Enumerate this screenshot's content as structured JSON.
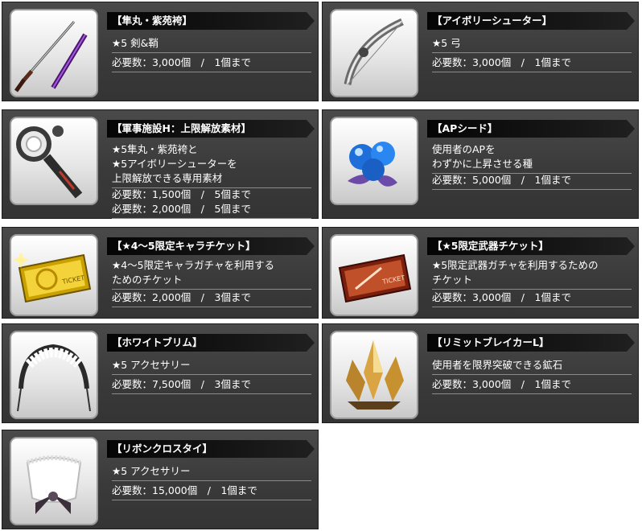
{
  "items": [
    {
      "title": "【隼丸・紫苑袴】",
      "desc": [
        "★5 剣&鞘"
      ],
      "req": [
        "必要数：3,000個　/　1個まで"
      ],
      "icon": "katana-icon"
    },
    {
      "title": "【アイボリーシューター】",
      "desc": [
        "★5 弓"
      ],
      "req": [
        "必要数：3,000個　/　1個まで"
      ],
      "icon": "bow-icon"
    },
    {
      "title": "【軍事施設H：上限解放素材】",
      "desc": [
        "★5隼丸・紫苑袴と",
        "★5アイボリーシューターを",
        "上限解放できる専用素材"
      ],
      "req": [
        "必要数：1,500個　/　5個まで",
        "必要数：2,000個　/　5個まで"
      ],
      "icon": "searchlight-icon"
    },
    {
      "title": "【APシード】",
      "desc": [
        "使用者のAPを",
        "わずかに上昇させる種"
      ],
      "req": [
        "必要数：5,000個　/　1個まで"
      ],
      "icon": "blue-seed-icon"
    },
    {
      "title": "【★4～5限定キャラチケット】",
      "desc": [
        "★4～5限定キャラガチャを利用する",
        "ためのチケット"
      ],
      "req": [
        "必要数：2,000個　/　3個まで"
      ],
      "icon": "gold-ticket-icon"
    },
    {
      "title": "【★5限定武器チケット】",
      "desc": [
        "★5限定武器ガチャを利用するための",
        "チケット"
      ],
      "req": [
        "必要数：3,000個　/　1個まで"
      ],
      "icon": "red-ticket-icon"
    },
    {
      "title": "【ホワイトブリム】",
      "desc": [
        "★5 アクセサリー"
      ],
      "req": [
        "必要数：7,500個　/　3個まで"
      ],
      "icon": "maid-headband-icon"
    },
    {
      "title": "【リミットブレイカーL】",
      "desc": [
        "使用者を限界突破できる鉱石"
      ],
      "req": [
        "必要数：3,000個　/　1個まで"
      ],
      "icon": "crystal-ore-icon"
    },
    {
      "title": "【リボンクロスタイ】",
      "desc": [
        "★5 アクセサリー"
      ],
      "req": [
        "必要数：15,000個　/　1個まで"
      ],
      "icon": "ribbon-tie-icon"
    }
  ]
}
